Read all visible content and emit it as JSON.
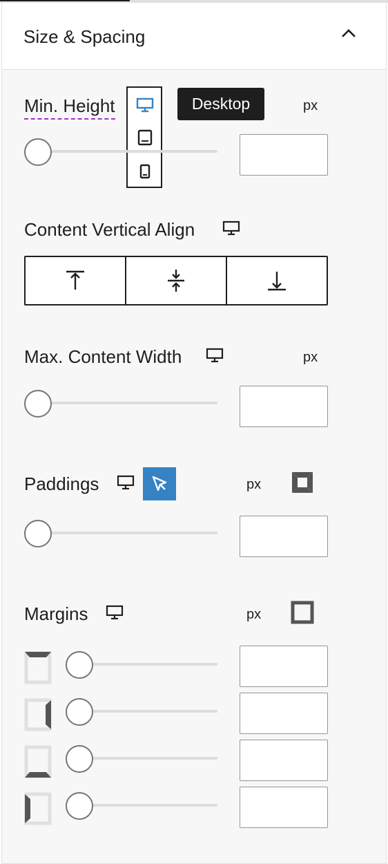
{
  "panel": {
    "title": "Size & Spacing"
  },
  "min_height": {
    "label": "Min. Height",
    "unit": "px",
    "value": "",
    "device_tooltip": "Desktop",
    "devices": [
      "desktop-icon",
      "tablet-icon",
      "mobile-icon"
    ],
    "active_device": "desktop"
  },
  "content_vertical_align": {
    "label": "Content Vertical Align",
    "options": [
      "align-top-icon",
      "align-center-icon",
      "align-bottom-icon"
    ]
  },
  "max_content_width": {
    "label": "Max. Content Width",
    "unit": "px",
    "value": ""
  },
  "paddings": {
    "label": "Paddings",
    "unit": "px",
    "value": ""
  },
  "margins": {
    "label": "Margins",
    "unit": "px",
    "sides": [
      "top",
      "right",
      "bottom",
      "left"
    ],
    "values": [
      "",
      "",
      "",
      ""
    ]
  },
  "colors": {
    "accent": "#3582c4",
    "tooltip_bg": "#1e1e1e",
    "dashed_underline": "#a033c2",
    "panel_bg": "#f7f7f7"
  }
}
